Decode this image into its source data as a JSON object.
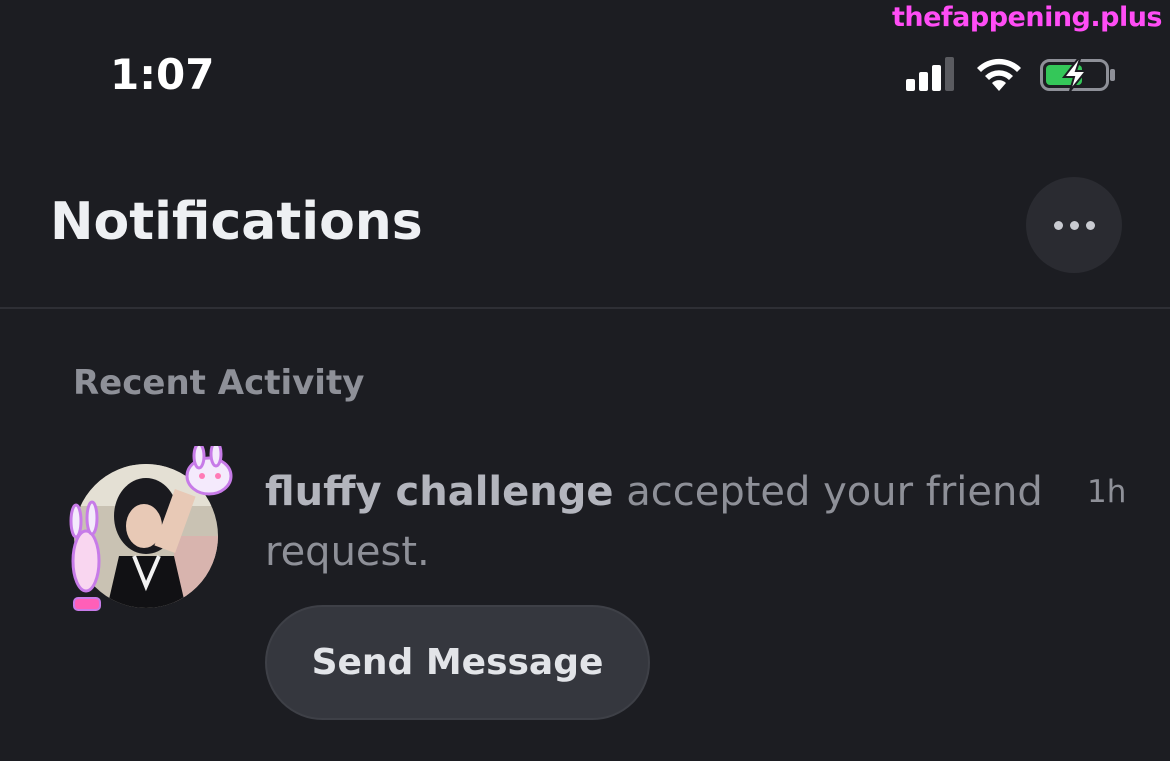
{
  "watermark": "thefappening.plus",
  "status_bar": {
    "time": "1:07",
    "icons": [
      "cellular-signal-icon",
      "wifi-icon",
      "battery-charging-icon"
    ],
    "battery_color": "#34c759"
  },
  "header": {
    "title": "Notifications",
    "more_icon": "ellipsis-icon"
  },
  "recent_activity": {
    "label": "Recent Activity",
    "items": [
      {
        "username": "fluffy challenge",
        "message": " accepted your friend request.",
        "time": "1h",
        "action_label": "Send Message",
        "avatar": "user-avatar-with-bunny-decoration"
      }
    ]
  },
  "colors": {
    "background": "#1c1d22",
    "accent_pink": "#ff4df5",
    "button_bg": "#35373e"
  }
}
